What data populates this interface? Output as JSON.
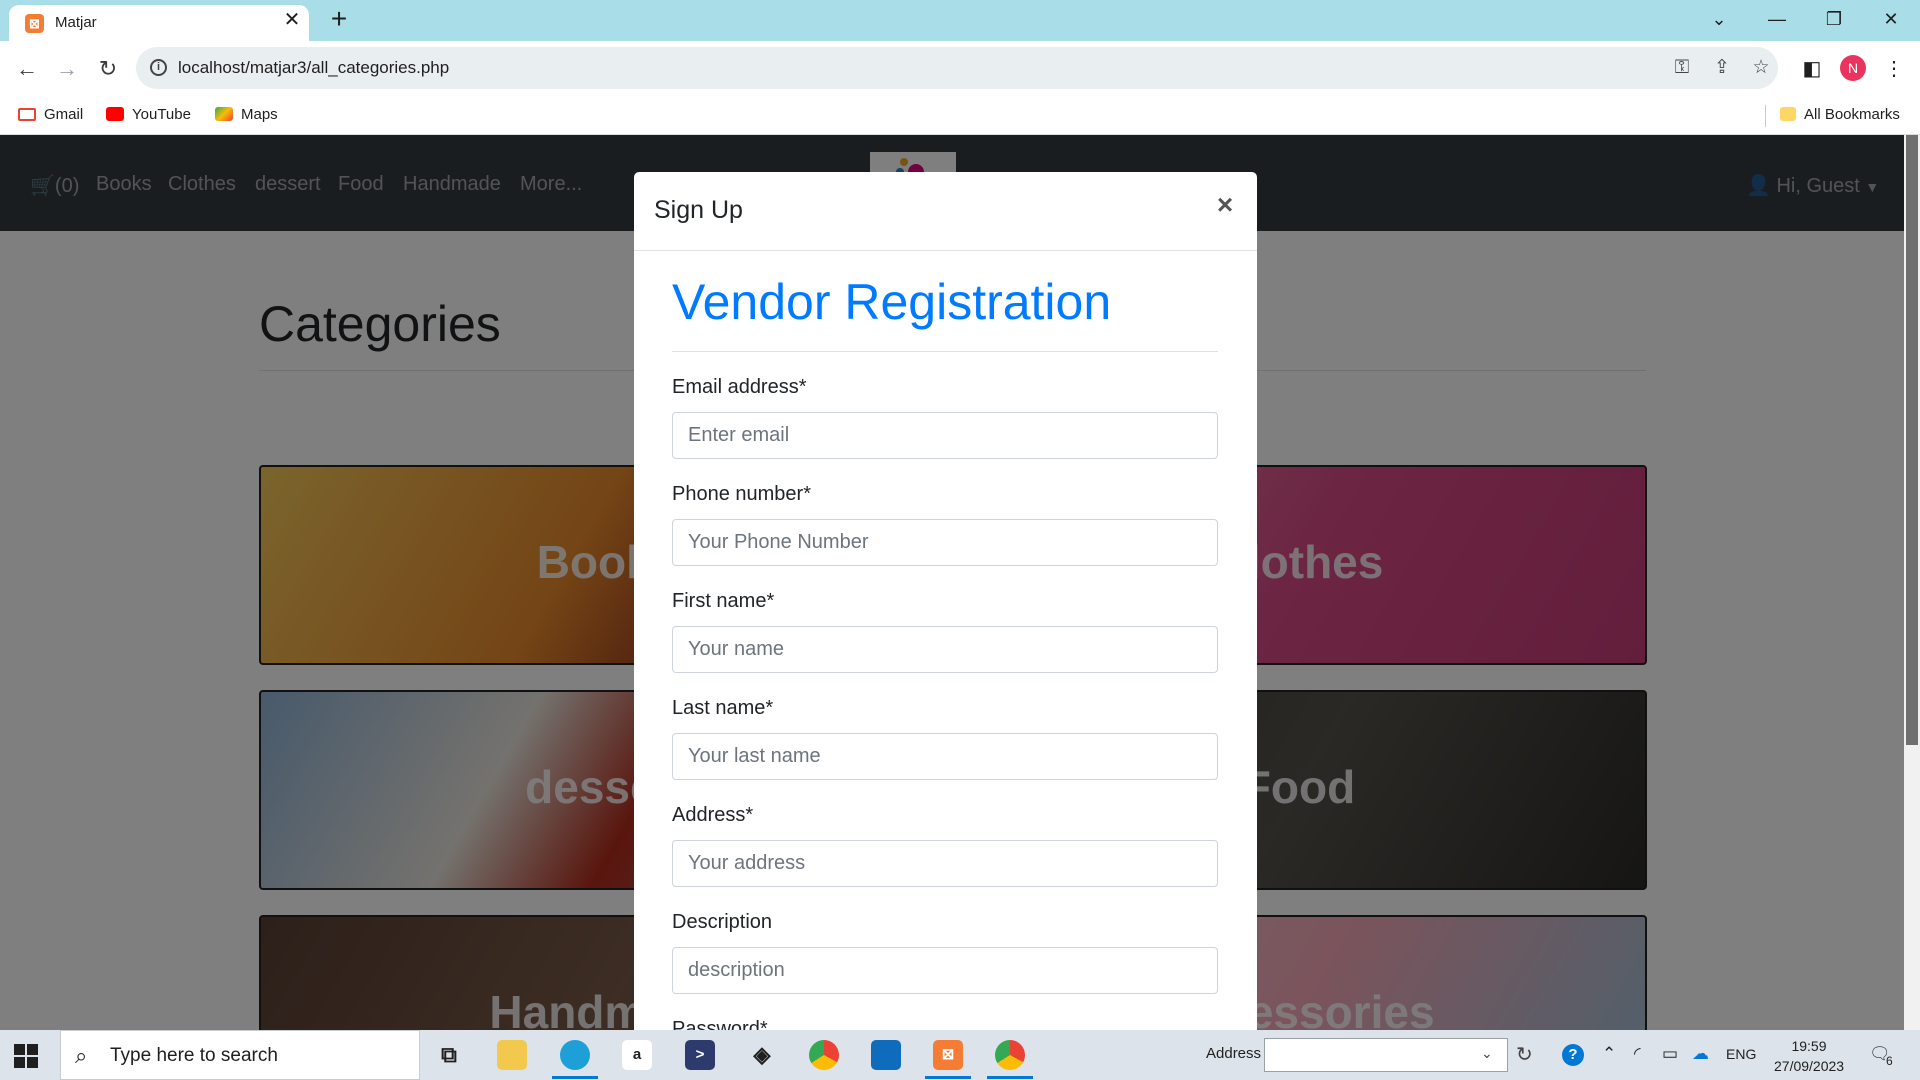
{
  "browser": {
    "tab_title": "Matjar",
    "url": "localhost/matjar3/all_categories.php",
    "profile_initial": "N",
    "bookmarks": [
      "Gmail",
      "YouTube",
      "Maps"
    ],
    "all_bookmarks": "All Bookmarks"
  },
  "site_nav": {
    "cart": "(0)",
    "links": [
      "Books",
      "Clothes",
      "dessert",
      "Food",
      "Handmade",
      "More..."
    ],
    "user_menu": "Hi, Guest"
  },
  "page": {
    "heading": "Categories",
    "categories": [
      "Books",
      "Clothes",
      "dessert",
      "Food",
      "Handmade",
      "Accessories"
    ]
  },
  "modal": {
    "title": "Sign Up",
    "close": "×",
    "heading": "Vendor Registration",
    "fields": [
      {
        "label": "Email address*",
        "placeholder": "Enter email"
      },
      {
        "label": "Phone number*",
        "placeholder": "Your Phone Number"
      },
      {
        "label": "First name*",
        "placeholder": "Your name"
      },
      {
        "label": "Last name*",
        "placeholder": "Your last name"
      },
      {
        "label": "Address*",
        "placeholder": "Your address"
      },
      {
        "label": "Description",
        "placeholder": "description"
      },
      {
        "label": "Password*",
        "placeholder": ""
      }
    ]
  },
  "taskbar": {
    "search_placeholder": "Type here to search",
    "address_label": "Address",
    "language": "ENG",
    "time": "19:59",
    "date": "27/09/2023",
    "notification_count": "6"
  },
  "colors": {
    "brand_blue": "#007bff",
    "navbar": "#343a40",
    "tabbar": "#a9dde8"
  }
}
